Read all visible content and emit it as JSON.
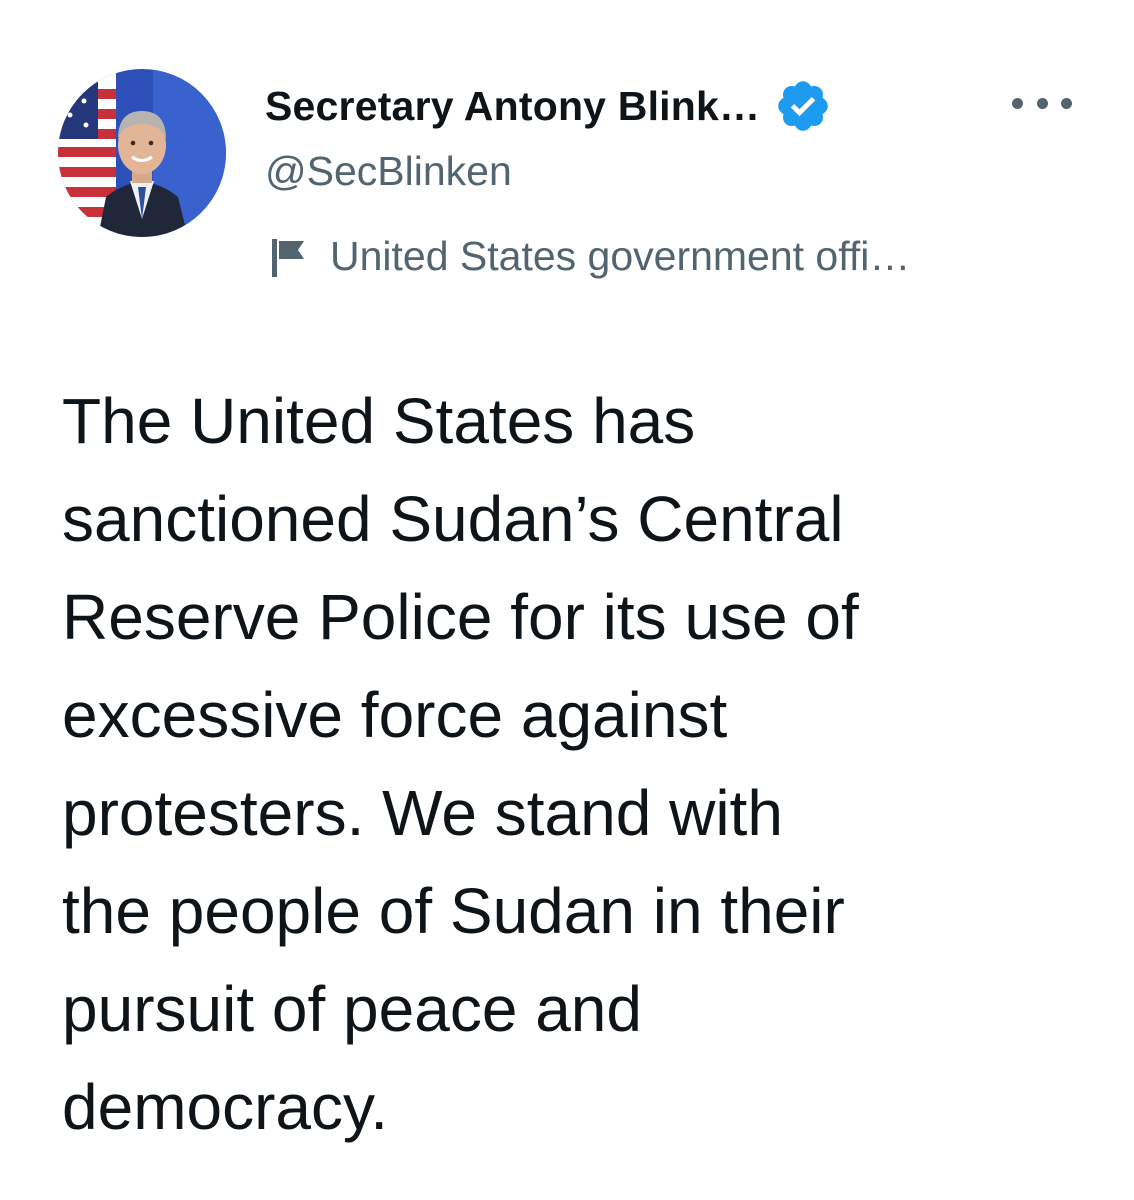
{
  "tweet": {
    "author": {
      "display_name": "Secretary Antony Blink…",
      "handle": "@SecBlinken",
      "verified_icon": "verified-badge-icon",
      "avatar_icon": "profile-photo",
      "label_icon": "flag-icon",
      "label_text": "United States government offi…"
    },
    "more_icon": "more-options-icon",
    "body": "The United States has\nsanctioned Sudan’s Central\nReserve Police for its use of\nexcessive force against\nprotesters. We stand with\nthe people of Sudan in their\npursuit of peace and\ndemocracy."
  },
  "colors": {
    "text_primary": "#0f1419",
    "text_secondary": "#536471",
    "verified_blue": "#1d9bf0",
    "background": "#ffffff"
  }
}
